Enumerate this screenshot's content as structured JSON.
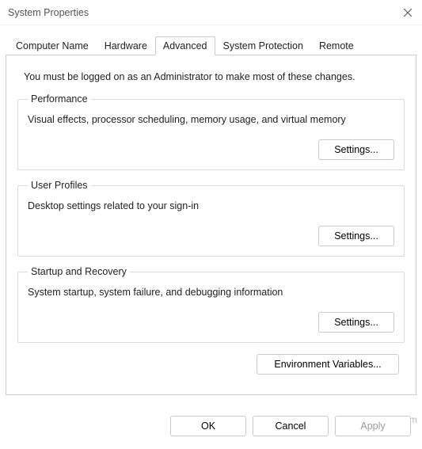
{
  "window": {
    "title": "System Properties"
  },
  "tabs": {
    "computer_name": "Computer Name",
    "hardware": "Hardware",
    "advanced": "Advanced",
    "system_protection": "System Protection",
    "remote": "Remote"
  },
  "advanced": {
    "intro": "You must be logged on as an Administrator to make most of these changes.",
    "performance": {
      "legend": "Performance",
      "desc": "Visual effects, processor scheduling, memory usage, and virtual memory",
      "button": "Settings..."
    },
    "user_profiles": {
      "legend": "User Profiles",
      "desc": "Desktop settings related to your sign-in",
      "button": "Settings..."
    },
    "startup_recovery": {
      "legend": "Startup and Recovery",
      "desc": "System startup, system failure, and debugging information",
      "button": "Settings..."
    },
    "env_button": "Environment Variables..."
  },
  "footer": {
    "ok": "OK",
    "cancel": "Cancel",
    "apply": "Apply"
  },
  "watermark": "wsxdn.com"
}
